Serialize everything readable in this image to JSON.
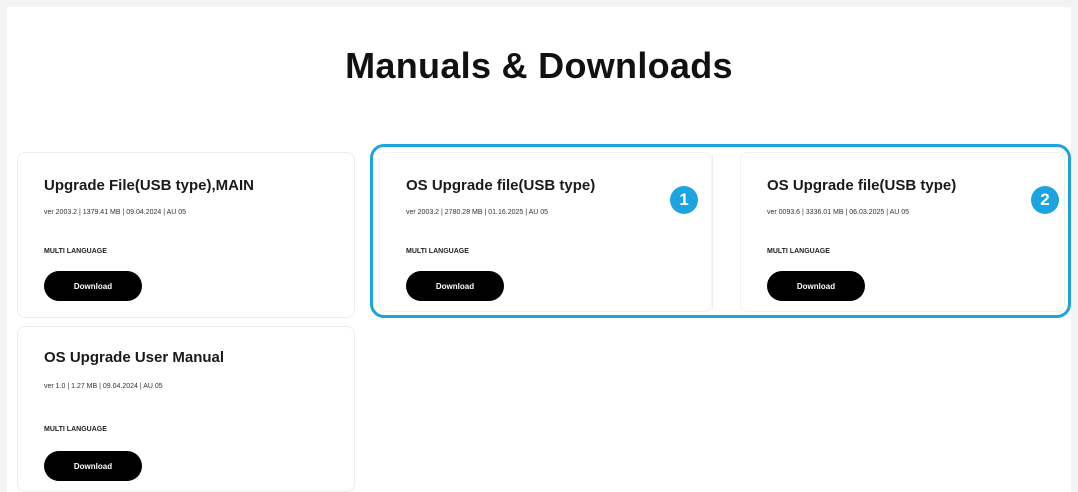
{
  "page": {
    "title": "Manuals & Downloads"
  },
  "cards": [
    {
      "title": "Upgrade File(USB type),MAIN",
      "meta": "ver 2003.2 | 1379.41 MB | 09.04.2024 | AU 05",
      "language": "MULTI LANGUAGE",
      "button": "Download"
    },
    {
      "title": "OS Upgrade file(USB type)",
      "meta": "ver 2003.2 | 2780.28 MB | 01.16.2025 | AU 05",
      "language": "MULTI LANGUAGE",
      "button": "Download"
    },
    {
      "title": "OS Upgrade file(USB type)",
      "meta": "ver 0093.6 | 3336.01 MB | 06.03.2025 | AU 05",
      "language": "MULTI LANGUAGE",
      "button": "Download"
    },
    {
      "title": "OS Upgrade User Manual",
      "meta": "ver 1.0 | 1.27 MB | 09.04.2024 | AU 05",
      "language": "MULTI LANGUAGE",
      "button": "Download"
    }
  ],
  "annotations": {
    "badge_1": "1",
    "badge_2": "2",
    "highlight_color": "#1ea3e1"
  }
}
